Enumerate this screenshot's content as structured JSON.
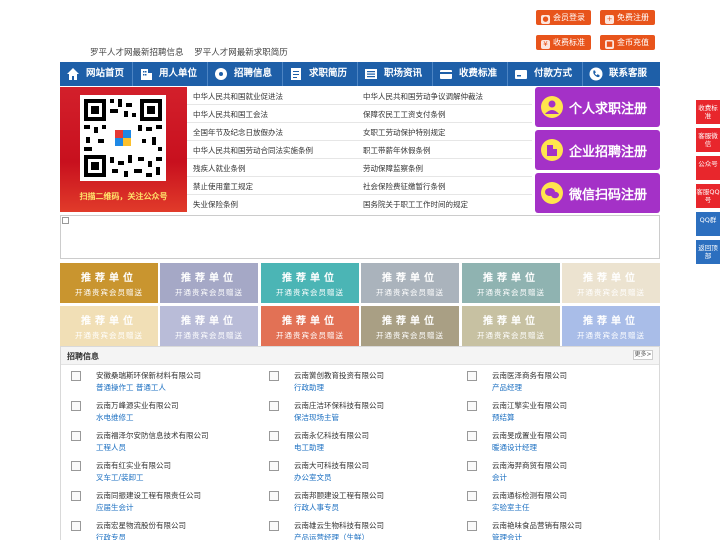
{
  "header": {
    "links": [
      "罗平人才网最新招聘信息",
      "罗平人才网最新求职简历"
    ],
    "buttons": [
      {
        "label": "会员登录",
        "icon": "user-icon"
      },
      {
        "label": "免费注册",
        "icon": "person-plus-icon"
      },
      {
        "label": "收费标准",
        "icon": "yen-icon"
      },
      {
        "label": "金币充值",
        "icon": "coin-icon"
      }
    ]
  },
  "nav": [
    {
      "label": "网站首页",
      "icon": "home-icon"
    },
    {
      "label": "用人单位",
      "icon": "building-icon"
    },
    {
      "label": "招聘信息",
      "icon": "broadcast-icon"
    },
    {
      "label": "求职简历",
      "icon": "resume-icon"
    },
    {
      "label": "职场资讯",
      "icon": "news-icon"
    },
    {
      "label": "收费标准",
      "icon": "fee-icon"
    },
    {
      "label": "付款方式",
      "icon": "payment-icon"
    },
    {
      "label": "联系客服",
      "icon": "phone-icon"
    }
  ],
  "qr": {
    "caption": "扫描二维码，关注公众号"
  },
  "laws": {
    "left": [
      "中华人民共和国就业促进法",
      "中华人民共和国工会法",
      "全国年节及纪念日放假办法",
      "中华人民共和国劳动合同法实施条例",
      "残疾人就业条例",
      "禁止使用童工规定",
      "失业保险条例"
    ],
    "right": [
      "中华人民共和国劳动争议调解仲裁法",
      "保障农民工工资支付条例",
      "女职工劳动保护特别规定",
      "职工带薪年休假条例",
      "劳动保障监察条例",
      "社会保险费征缴暂行条例",
      "国务院关于职工工作时间的规定"
    ]
  },
  "register": [
    {
      "label": "个人求职注册",
      "icon": "person-icon"
    },
    {
      "label": "企业招聘注册",
      "icon": "enterprise-icon"
    },
    {
      "label": "微信扫码注册",
      "icon": "wechat-icon"
    }
  ],
  "tiles": {
    "title": "推荐单位",
    "subtitle": "开通贵宾会员赠送",
    "colors": [
      "#c9952f",
      "#a5a8c6",
      "#4bb5b5",
      "#aab3bc",
      "#8fb3b1",
      "#ece3d0",
      "#f1dfb6",
      "#b9bcd8",
      "#e27155",
      "#a99f84",
      "#c7c1a2",
      "#a9bde8"
    ]
  },
  "jobs": {
    "title": "招聘信息",
    "more": "更多>",
    "items": [
      {
        "company": "安徽桑瑞斯环保新材料有限公司",
        "position": "普通操作工 普通工人"
      },
      {
        "company": "云南黉创教育投资有限公司",
        "position": "行政助理"
      },
      {
        "company": "云南医泽商务有限公司",
        "position": "产品经理"
      },
      {
        "company": "云南万峰源实业有限公司",
        "position": "水电维修工"
      },
      {
        "company": "云南庄洁环保科技有限公司",
        "position": "保洁现场主管"
      },
      {
        "company": "云南江擎实业有限公司",
        "position": "预结算"
      },
      {
        "company": "云南福泽尔安防信息技术有限公司",
        "position": "工程人员"
      },
      {
        "company": "云南永亿科技有限公司",
        "position": "电工助理"
      },
      {
        "company": "云南旻成置业有限公司",
        "position": "暖通设计经理"
      },
      {
        "company": "云南有红实业有限公司",
        "position": "叉车工/装卸工"
      },
      {
        "company": "云南大可科技有限公司",
        "position": "办公室文员"
      },
      {
        "company": "云南海羿商贸有限公司",
        "position": "会计"
      },
      {
        "company": "云南同振建设工程有限责任公司",
        "position": "应届生会计"
      },
      {
        "company": "云南邦颐建设工程有限公司",
        "position": "行政人事专员"
      },
      {
        "company": "云南通标检测有限公司",
        "position": "实验室主任"
      },
      {
        "company": "云南宏星物流股份有限公司",
        "position": "行政专员"
      },
      {
        "company": "云南雄云生物科技有限公司",
        "position": "产品运营经理（生鲜）"
      },
      {
        "company": "云南艳味食品营销有限公司",
        "position": "管理会计"
      }
    ]
  },
  "sidebar": [
    {
      "label": "收费标准",
      "color": "#e8262c"
    },
    {
      "label": "客服微信",
      "color": "#e8262c"
    },
    {
      "label": "公众号",
      "color": "#e8262c"
    },
    {
      "label": "客服QQ号",
      "color": "#e8262c"
    },
    {
      "label": "QQ群",
      "color": "#2c6fbf"
    },
    {
      "label": "返回顶部",
      "color": "#2c6fbf"
    }
  ]
}
